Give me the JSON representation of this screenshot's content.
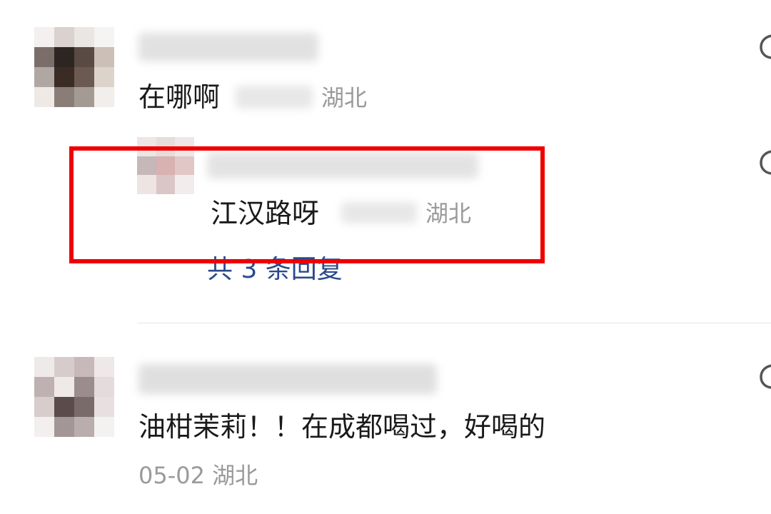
{
  "comments": [
    {
      "text": "在哪啊",
      "location": "湖北",
      "avatar_colors": [
        "#f3f0ef",
        "#d9d2cf",
        "#e9e6e4",
        "#f6f4f2",
        "#7b6e6a",
        "#2d2521",
        "#5a4a44",
        "#cbbfb7",
        "#b0a7a3",
        "#3a2b25",
        "#6a5a52",
        "#dcd3cb",
        "#efe9e6",
        "#8a7d77",
        "#a49a94",
        "#f1eeec"
      ]
    },
    {
      "text": "江汉路呀",
      "location": "湖北",
      "avatar_colors": [
        "#ece6e6",
        "#e7dcdc",
        "#efe7e7",
        "#c6b7b8",
        "#d8b1b1",
        "#e2c7c7",
        "#efe4e4",
        "#dac6c6",
        "#f3ecec"
      ]
    },
    {
      "text": "油柑茉莉！！在成都喝过，好喝的",
      "date": "05-02",
      "location": "湖北",
      "avatar_colors": [
        "#efeaea",
        "#d7cccc",
        "#c7b9b9",
        "#eee8e8",
        "#bfb1b1",
        "#efe9e9",
        "#9b8d8d",
        "#e4dcdc",
        "#d7cdcd",
        "#5b4b4b",
        "#7a6b6b",
        "#e8e0e0",
        "#f3efef",
        "#a39696",
        "#b9adad",
        "#f4f1f1"
      ]
    }
  ],
  "reply_count_label": "共 3 条回复",
  "colors": {
    "highlight": "#ee0000",
    "link": "#2b4a8b",
    "meta": "#9a9a9a"
  },
  "icons": {
    "like": "like-icon"
  }
}
